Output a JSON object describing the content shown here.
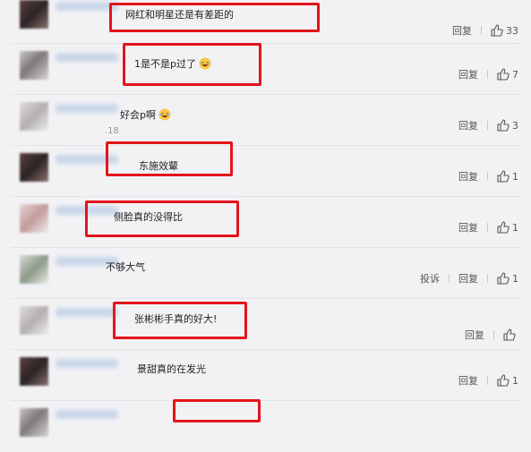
{
  "comments": [
    {
      "text": "网红和明星还是有差距的",
      "tag": "",
      "reply": "回复",
      "likes": "33"
    },
    {
      "text": "1是不是p过了",
      "tag": "",
      "reply": "回复",
      "likes": "7"
    },
    {
      "text": "好会p啊",
      "tag": ".18",
      "reply": "回复",
      "likes": "3"
    },
    {
      "text": "东施效颦",
      "tag": "",
      "reply": "回复",
      "likes": "1"
    },
    {
      "text": "侧脸真的没得比",
      "tag": "",
      "reply": "回复",
      "likes": "1"
    },
    {
      "text": "不够大气",
      "tag": "",
      "report": "投诉",
      "reply": "回复",
      "likes": "1"
    },
    {
      "text": "张彬彬手真的好大!",
      "tag": "",
      "reply": "回复",
      "likes": ""
    },
    {
      "text": "景甜真的在发光",
      "tag": "",
      "reply": "回复",
      "likes": "1"
    }
  ],
  "colors": {
    "highlight_box": "#e3141b",
    "background": "#f2f2f5"
  },
  "icons": {
    "like": "thumbs-up-icon",
    "laugh": "laughing-emoji-icon"
  }
}
